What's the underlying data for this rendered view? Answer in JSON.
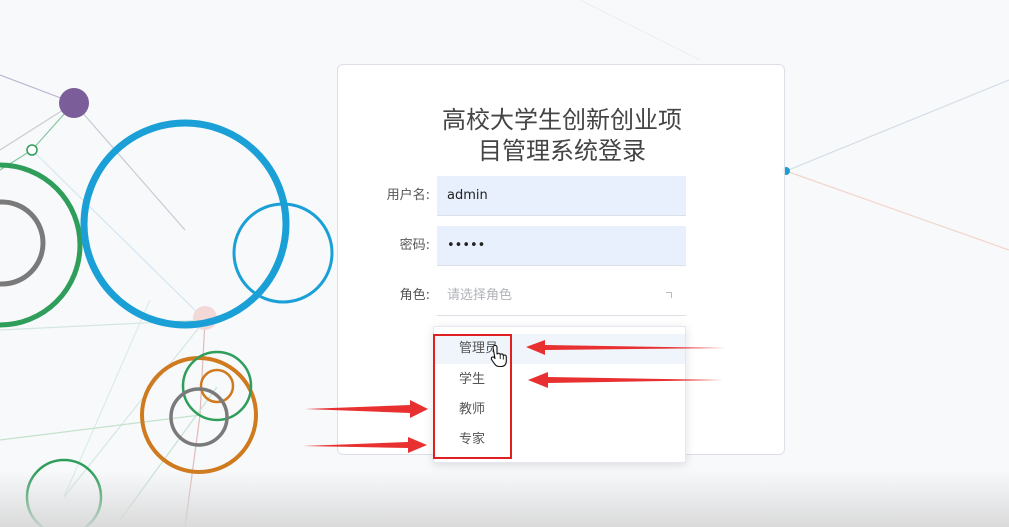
{
  "login": {
    "title_line1": "高校大学生创新创业项",
    "title_line2": "目管理系统登录",
    "username_label": "用户名:",
    "username_value": "admin",
    "password_label": "密码:",
    "password_value": "admin",
    "role_label": "角色:",
    "role_placeholder": "请选择角色"
  },
  "role_options": [
    "管理员",
    "学生",
    "教师",
    "专家"
  ],
  "icons": {
    "cursor": "hand-pointer-icon",
    "caret": "chevron-up-icon"
  },
  "colors": {
    "annotation_red": "#e02020",
    "autofill_bg": "#e8f0fe",
    "card_border": "#dcdfe6"
  }
}
